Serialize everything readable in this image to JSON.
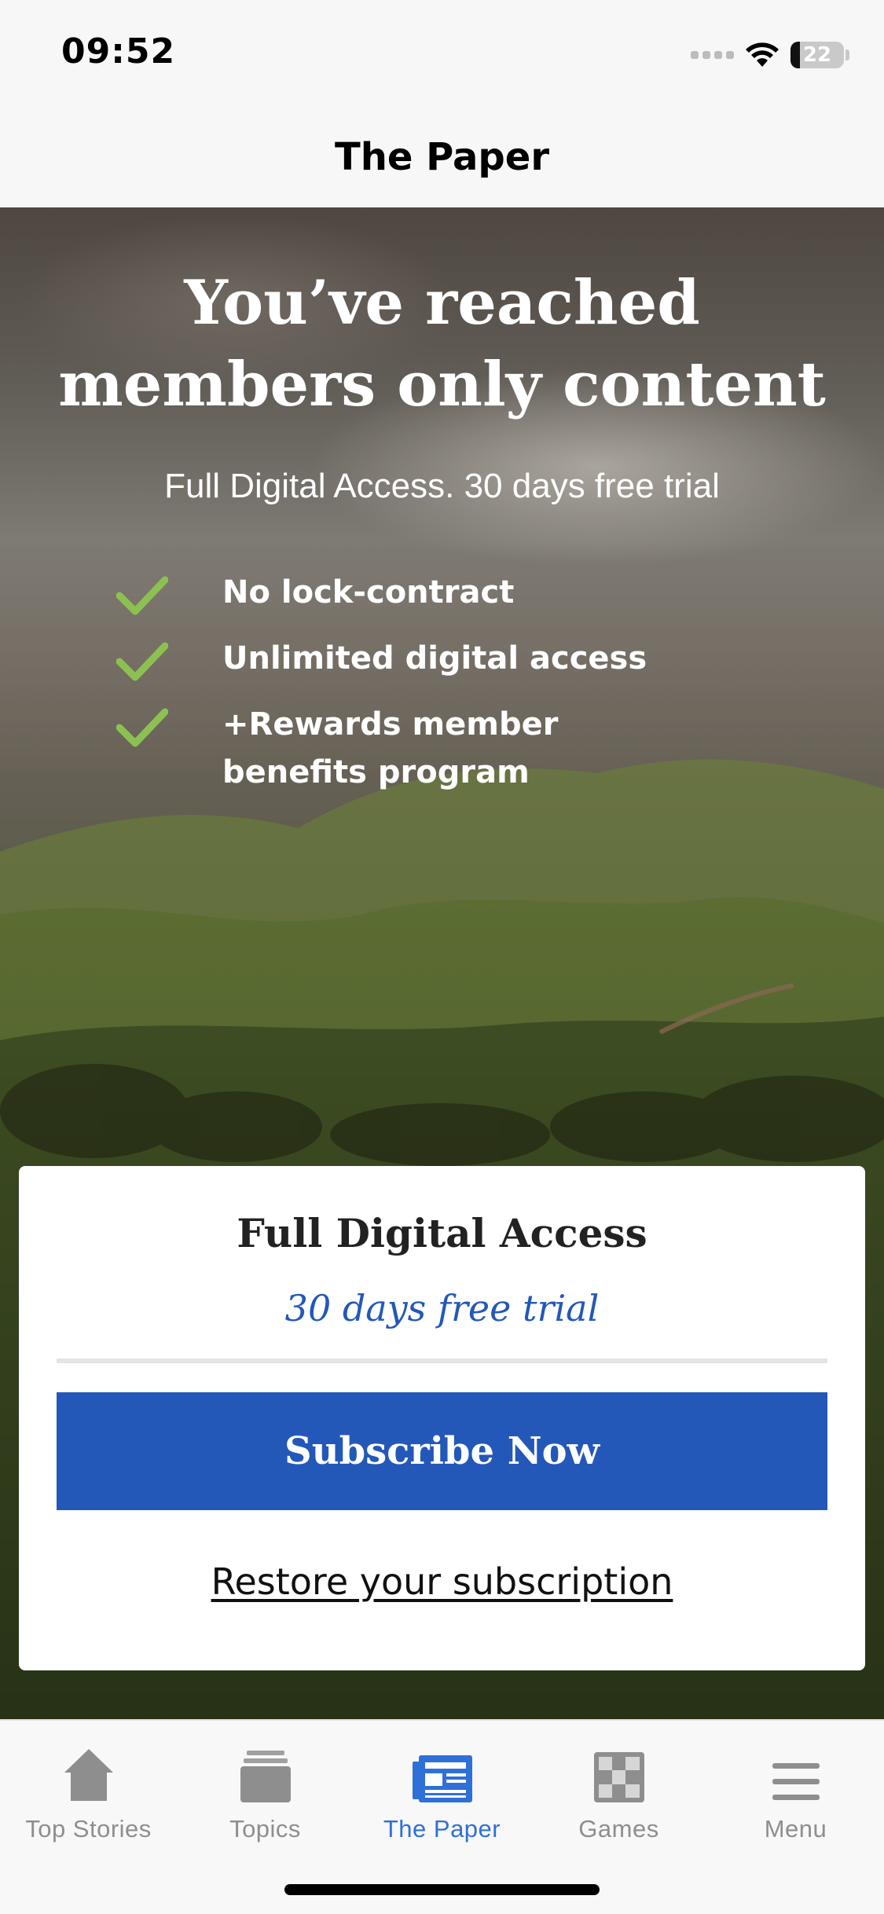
{
  "status_bar": {
    "time": "09:52",
    "battery_level": "22",
    "icons": [
      "cellular-signal-icon",
      "wifi-icon",
      "battery-icon"
    ]
  },
  "nav": {
    "title": "The Paper"
  },
  "paywall": {
    "heading": "You’ve reached members only content",
    "subtitle": "Full Digital Access. 30 days free trial",
    "benefits": [
      "No lock-contract",
      "Unlimited digital access",
      "+Rewards member benefits program"
    ],
    "check_color": "#8cc152"
  },
  "offer": {
    "title": "Full Digital Access",
    "trial": "30 days free trial",
    "subscribe_label": "Subscribe Now",
    "restore_label": "Restore your subscription",
    "accent_color": "#2358b8"
  },
  "tab_bar": {
    "active_tab": "The Paper",
    "tabs": [
      {
        "label": "Top Stories",
        "icon": "home-icon"
      },
      {
        "label": "Topics",
        "icon": "topics-stack-icon"
      },
      {
        "label": "The Paper",
        "icon": "newspaper-icon"
      },
      {
        "label": "Games",
        "icon": "checkerboard-icon"
      },
      {
        "label": "Menu",
        "icon": "hamburger-menu-icon"
      }
    ],
    "active_color": "#2f6fd8",
    "inactive_color": "#8e8e8e"
  }
}
